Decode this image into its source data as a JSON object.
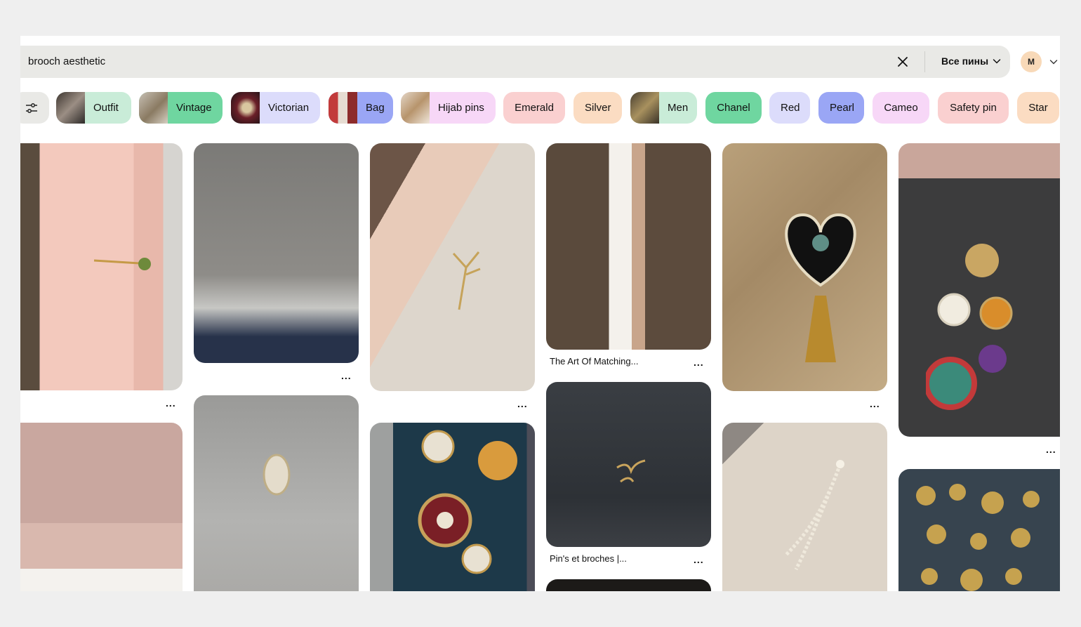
{
  "search": {
    "query": "brooch aesthetic",
    "scope_label": "Все пины"
  },
  "account": {
    "initial": "M"
  },
  "chips": [
    {
      "label": "Outfit",
      "color": "#c9ecd8",
      "thumb": "#7a6f66"
    },
    {
      "label": "Vintage",
      "color": "#6fd6a0",
      "thumb": "#9a8e7a"
    },
    {
      "label": "Victorian",
      "color": "#dcdcfb",
      "thumb": "#5a2a2e"
    },
    {
      "label": "Bag",
      "color": "#9aa6f5",
      "thumb": "#b84848"
    },
    {
      "label": "Hijab pins",
      "color": "#f7d7f7",
      "thumb": "#c7a27d"
    },
    {
      "label": "Emerald",
      "color": "#fad0d0"
    },
    {
      "label": "Silver",
      "color": "#fbdcc2"
    },
    {
      "label": "Men",
      "color": "#c9ecd8",
      "thumb": "#6b5b3a"
    },
    {
      "label": "Chanel",
      "color": "#6fd6a0"
    },
    {
      "label": "Red",
      "color": "#dcdcfb"
    },
    {
      "label": "Pearl",
      "color": "#9aa6f5"
    },
    {
      "label": "Cameo",
      "color": "#f7d7f7"
    },
    {
      "label": "Safety pin",
      "color": "#fad0d0"
    },
    {
      "label": "Star",
      "color": "#fbdcc2"
    }
  ],
  "pins": {
    "art_of_matching": {
      "caption": "The Art Of Matching..."
    },
    "pins_et_broches": {
      "caption": "Pin's et broches |..."
    }
  },
  "more_label": "..."
}
